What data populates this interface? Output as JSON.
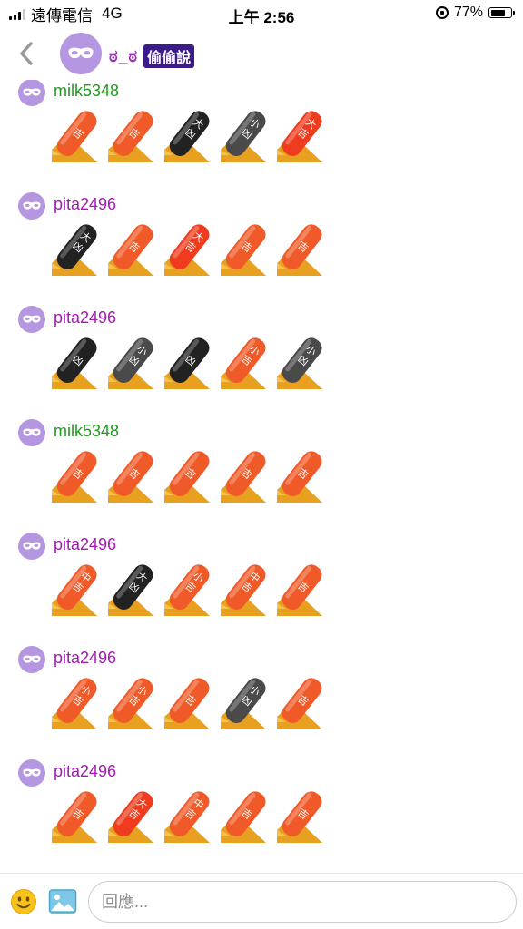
{
  "status_bar": {
    "carrier": "遠傳電信",
    "network": "4G",
    "time": "上午 2:56",
    "battery": "77%",
    "battery_level": 0.77
  },
  "header": {
    "back_icon": "chevron-left-icon",
    "avatar_icon": "mask-icon",
    "emoji": "ಠ_ಠ",
    "badge": "偷偷說"
  },
  "colors": {
    "avatar": "#b497e0",
    "green_user": "#1e9a1e",
    "purple_user": "#a418b4",
    "badge_bg": "#3b1a8a",
    "stick_red": "#f03c1e",
    "stick_orange": "#f05a28",
    "stick_black": "#222222",
    "stick_gray": "#4a4a4a",
    "holder": "#e8a020"
  },
  "messages": [
    {
      "user": "milk5348",
      "color": "green",
      "sticks": [
        {
          "tone": "orange",
          "top": "",
          "bottom": "吉"
        },
        {
          "tone": "orange",
          "top": "",
          "bottom": "吉"
        },
        {
          "tone": "black",
          "top": "大",
          "bottom": "凶"
        },
        {
          "tone": "gray",
          "top": "小",
          "bottom": "凶"
        },
        {
          "tone": "red",
          "top": "大",
          "bottom": "吉"
        }
      ]
    },
    {
      "user": "pita2496",
      "color": "purple",
      "sticks": [
        {
          "tone": "black",
          "top": "大",
          "bottom": "凶"
        },
        {
          "tone": "orange",
          "top": "",
          "bottom": "吉"
        },
        {
          "tone": "red",
          "top": "大",
          "bottom": "吉"
        },
        {
          "tone": "orange",
          "top": "",
          "bottom": "吉"
        },
        {
          "tone": "orange",
          "top": "",
          "bottom": "吉"
        }
      ]
    },
    {
      "user": "pita2496",
      "color": "purple",
      "sticks": [
        {
          "tone": "black",
          "top": "",
          "bottom": "凶"
        },
        {
          "tone": "gray",
          "top": "小",
          "bottom": "凶"
        },
        {
          "tone": "black",
          "top": "",
          "bottom": "凶"
        },
        {
          "tone": "orange",
          "top": "小",
          "bottom": "吉"
        },
        {
          "tone": "gray",
          "top": "小",
          "bottom": "凶"
        }
      ]
    },
    {
      "user": "milk5348",
      "color": "green",
      "sticks": [
        {
          "tone": "orange",
          "top": "",
          "bottom": "吉"
        },
        {
          "tone": "orange",
          "top": "",
          "bottom": "吉"
        },
        {
          "tone": "orange",
          "top": "",
          "bottom": "吉"
        },
        {
          "tone": "orange",
          "top": "",
          "bottom": "吉"
        },
        {
          "tone": "orange",
          "top": "",
          "bottom": "吉"
        }
      ]
    },
    {
      "user": "pita2496",
      "color": "purple",
      "sticks": [
        {
          "tone": "orange",
          "top": "中",
          "bottom": "吉"
        },
        {
          "tone": "black",
          "top": "大",
          "bottom": "凶"
        },
        {
          "tone": "orange",
          "top": "小",
          "bottom": "吉"
        },
        {
          "tone": "orange",
          "top": "中",
          "bottom": "吉"
        },
        {
          "tone": "orange",
          "top": "",
          "bottom": "吉"
        }
      ]
    },
    {
      "user": "pita2496",
      "color": "purple",
      "sticks": [
        {
          "tone": "orange",
          "top": "小",
          "bottom": "吉"
        },
        {
          "tone": "orange",
          "top": "小",
          "bottom": "吉"
        },
        {
          "tone": "orange",
          "top": "",
          "bottom": "吉"
        },
        {
          "tone": "gray",
          "top": "小",
          "bottom": "凶"
        },
        {
          "tone": "orange",
          "top": "",
          "bottom": "吉"
        }
      ]
    },
    {
      "user": "pita2496",
      "color": "purple",
      "sticks": [
        {
          "tone": "orange",
          "top": "",
          "bottom": "吉"
        },
        {
          "tone": "red",
          "top": "大",
          "bottom": "吉"
        },
        {
          "tone": "orange",
          "top": "中",
          "bottom": "吉"
        },
        {
          "tone": "orange",
          "top": "",
          "bottom": "吉"
        },
        {
          "tone": "orange",
          "top": "",
          "bottom": "吉"
        }
      ]
    }
  ],
  "footer": {
    "emoji_icon": "smile-icon",
    "image_icon": "image-icon",
    "placeholder": "回應..."
  }
}
